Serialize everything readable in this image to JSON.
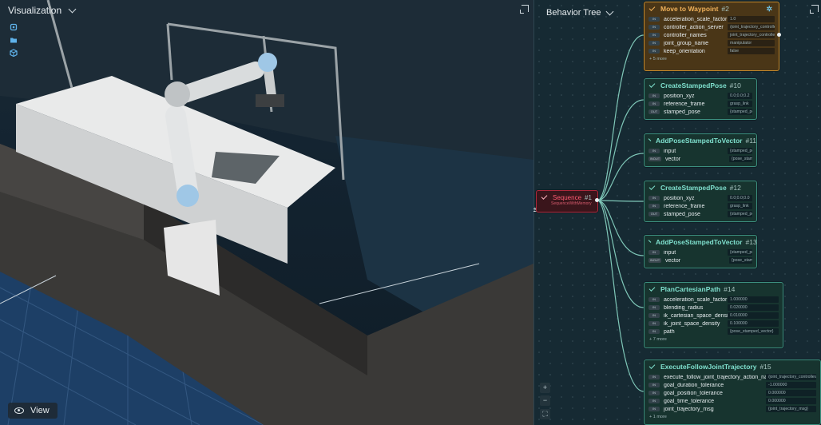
{
  "visualization": {
    "title": "Visualization",
    "view_label": "View",
    "tool_icons": [
      "robot-icon",
      "folder-open-icon",
      "cube-icon"
    ]
  },
  "behavior_tree": {
    "title": "Behavior Tree",
    "sequence": {
      "label": "Sequence",
      "id": "#1",
      "sub": "SequenceWithMemory"
    },
    "nodes": [
      {
        "name": "Move to Waypoint",
        "id": "#2",
        "status": "running",
        "ports": [
          {
            "tag": "IN",
            "name": "acceleration_scale_factor",
            "value": "1.0"
          },
          {
            "tag": "IN",
            "name": "controller_action_server",
            "value": "/joint_trajectory_controller/follow_joint_trajectory"
          },
          {
            "tag": "IN",
            "name": "controller_names",
            "value": "joint_trajectory_controller"
          },
          {
            "tag": "IN",
            "name": "joint_group_name",
            "value": "manipulator"
          },
          {
            "tag": "IN",
            "name": "keep_orientation",
            "value": "false"
          }
        ],
        "more": "+ 5 more"
      },
      {
        "name": "CreateStampedPose",
        "id": "#10",
        "status": "success",
        "ports": [
          {
            "tag": "IN",
            "name": "position_xyz",
            "value": "0.0;0.0;0.2"
          },
          {
            "tag": "IN",
            "name": "reference_frame",
            "value": "grasp_link"
          },
          {
            "tag": "OUT",
            "name": "stamped_pose",
            "value": "{stamped_pose}"
          }
        ]
      },
      {
        "name": "AddPoseStampedToVector",
        "id": "#11",
        "status": "success",
        "ports": [
          {
            "tag": "IN",
            "name": "input",
            "value": "{stamped_pose}"
          },
          {
            "tag": "INOUT",
            "name": "vector",
            "value": "{pose_stamped_vector}"
          }
        ]
      },
      {
        "name": "CreateStampedPose",
        "id": "#12",
        "status": "success",
        "ports": [
          {
            "tag": "IN",
            "name": "position_xyz",
            "value": "0.0;0.0;0.0"
          },
          {
            "tag": "IN",
            "name": "reference_frame",
            "value": "grasp_link"
          },
          {
            "tag": "OUT",
            "name": "stamped_pose",
            "value": "{stamped_pose}"
          }
        ]
      },
      {
        "name": "AddPoseStampedToVector",
        "id": "#13",
        "status": "success",
        "ports": [
          {
            "tag": "IN",
            "name": "input",
            "value": "{stamped_pose}"
          },
          {
            "tag": "INOUT",
            "name": "vector",
            "value": "{pose_stamped_vector}"
          }
        ]
      },
      {
        "name": "PlanCartesianPath",
        "id": "#14",
        "status": "success",
        "ports": [
          {
            "tag": "IN",
            "name": "acceleration_scale_factor",
            "value": "1.000000"
          },
          {
            "tag": "IN",
            "name": "blending_radius",
            "value": "0.020000"
          },
          {
            "tag": "IN",
            "name": "ik_cartesian_space_density",
            "value": "0.010000"
          },
          {
            "tag": "IN",
            "name": "ik_joint_space_density",
            "value": "0.100000"
          },
          {
            "tag": "IN",
            "name": "path",
            "value": "{pose_stamped_vector}"
          }
        ],
        "more": "+ 7 more"
      },
      {
        "name": "ExecuteFollowJointTrajectory",
        "id": "#15",
        "status": "success",
        "ports": [
          {
            "tag": "IN",
            "name": "execute_follow_joint_trajectory_action_name",
            "value": "/joint_trajectory_controller/follow_joint_trajectory"
          },
          {
            "tag": "IN",
            "name": "goal_duration_tolerance",
            "value": "-1.000000"
          },
          {
            "tag": "IN",
            "name": "goal_position_tolerance",
            "value": "0.000000"
          },
          {
            "tag": "IN",
            "name": "goal_time_tolerance",
            "value": "0.000000"
          },
          {
            "tag": "IN",
            "name": "joint_trajectory_msg",
            "value": "{joint_trajectory_msg}"
          }
        ],
        "more": "+ 1 more"
      }
    ],
    "zoom_controls": [
      "zoom-in-icon",
      "zoom-out-icon",
      "fit-view-icon"
    ]
  },
  "colors": {
    "running": "#c58a2c",
    "success": "#3c8f7f",
    "sequence": "#b0283b"
  }
}
